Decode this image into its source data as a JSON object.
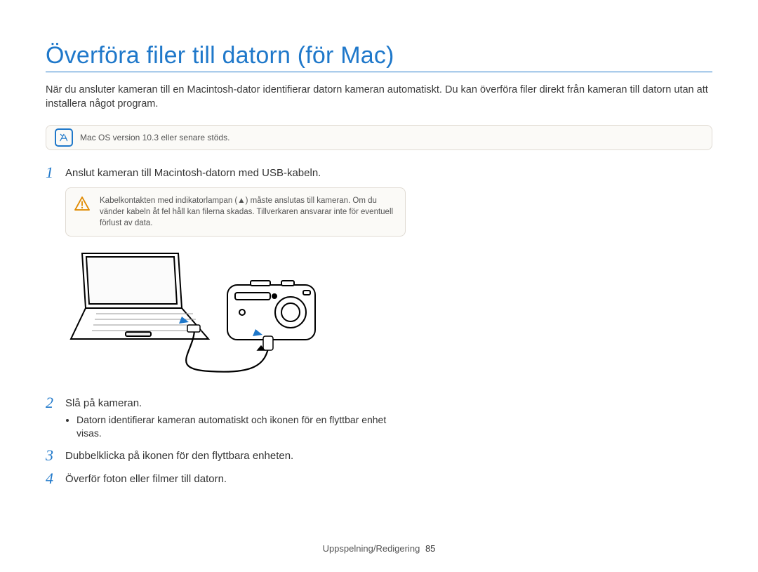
{
  "title": "Överföra filer till datorn (för Mac)",
  "intro": "När du ansluter kameran till en Macintosh-dator identifierar datorn kameran automatiskt. Du kan överföra filer direkt från kameran till datorn utan att installera något program.",
  "note": "Mac OS version 10.3 eller senare stöds.",
  "steps": [
    {
      "num": "1",
      "text": "Anslut kameran till Macintosh-datorn med USB-kabeln.",
      "warning": "Kabelkontakten med indikatorlampan (▲) måste anslutas till kameran. Om du vänder kabeln åt fel håll kan filerna skadas. Tillverkaren ansvarar inte för eventuell förlust av data."
    },
    {
      "num": "2",
      "text": "Slå på kameran.",
      "bullet": "Datorn identifierar kameran automatiskt och ikonen för en flyttbar enhet visas."
    },
    {
      "num": "3",
      "text": "Dubbelklicka på ikonen för den flyttbara enheten."
    },
    {
      "num": "4",
      "text": "Överför foton eller filmer till datorn."
    }
  ],
  "footer": {
    "section": "Uppspelning/Redigering",
    "page": "85"
  }
}
